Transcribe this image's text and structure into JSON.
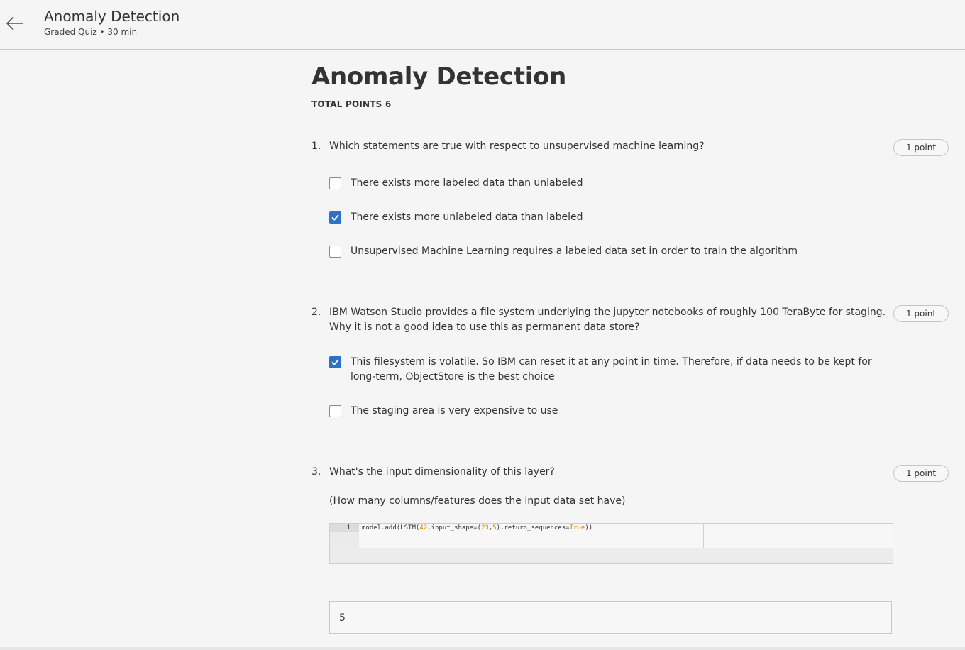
{
  "header": {
    "title": "Anomaly Detection",
    "subtitle": "Graded Quiz • 30 min"
  },
  "quiz": {
    "title": "Anomaly Detection",
    "total_points": "TOTAL POINTS 6"
  },
  "questions": [
    {
      "number": "1.",
      "text": "Which statements are true with respect to unsupervised machine learning?",
      "points": "1 point",
      "options": [
        {
          "label": "There exists more labeled data than unlabeled",
          "checked": false
        },
        {
          "label": "There exists more unlabeled data than labeled",
          "checked": true
        },
        {
          "label": "Unsupervised Machine Learning requires a labeled data set in order to train the algorithm",
          "checked": false
        }
      ]
    },
    {
      "number": "2.",
      "text": "IBM Watson Studio provides a file system underlying the jupyter notebooks of roughly 100 TeraByte for staging. Why it is not a good idea to use this as permanent data store?",
      "points": "1 point",
      "options": [
        {
          "label": "This filesystem is volatile. So IBM can reset it at any point in time. Therefore, if data needs to be kept for long-term, ObjectStore is the best choice",
          "checked": true
        },
        {
          "label": "The staging area is very expensive to use",
          "checked": false
        }
      ]
    },
    {
      "number": "3.",
      "text": "What's the input dimensionality of this layer?",
      "subtext": "(How many columns/features does the input data set have)",
      "points": "1 point",
      "code": {
        "line_number": "1",
        "line": "model.add(LSTM(42,input_shape=(23,5),return_sequences=True))",
        "parts": [
          "model.add(LSTM(",
          "42",
          ",input_shape=(",
          "23",
          ",",
          "5",
          "),return_sequences=",
          "True",
          "))"
        ]
      },
      "answer": "5"
    }
  ]
}
